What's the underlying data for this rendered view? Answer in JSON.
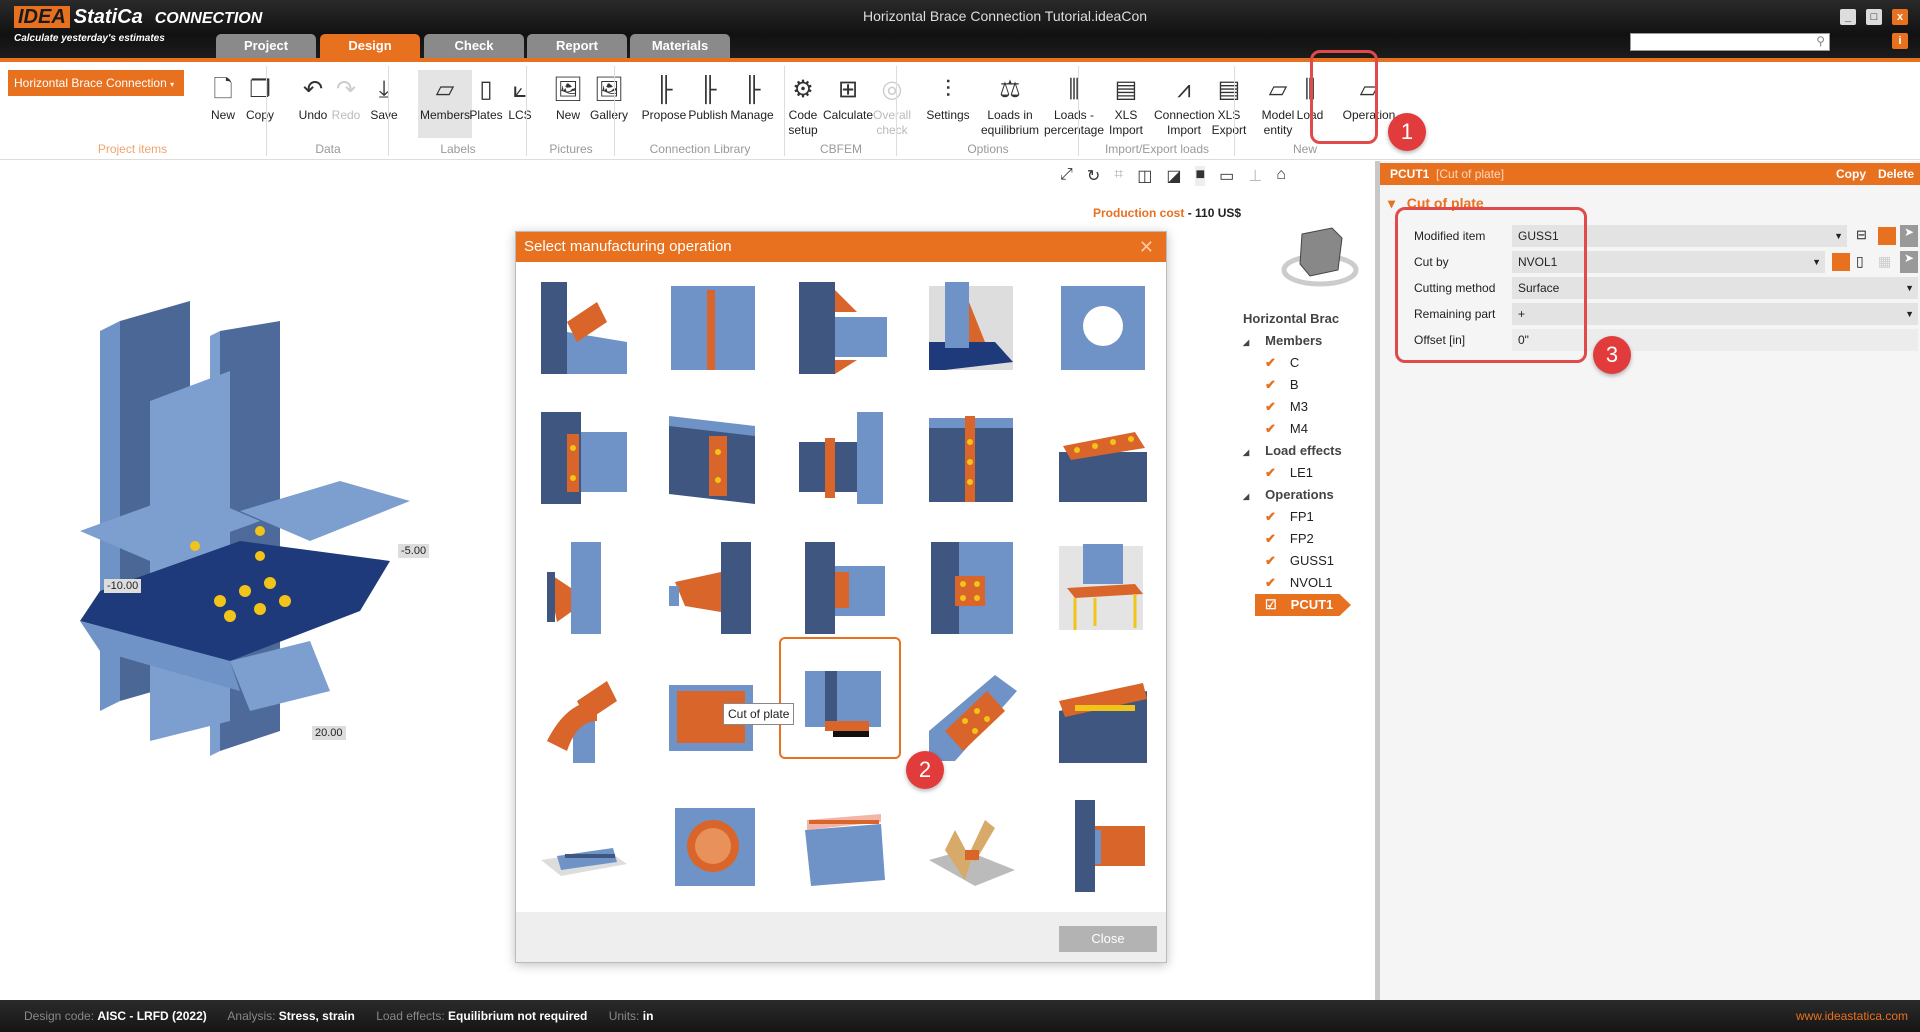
{
  "app": {
    "brand": "IDEA",
    "brand2": "StatiCa",
    "product": "CONNECTION",
    "slogan": "Calculate yesterday's estimates",
    "window_title": "Horizontal Brace Connection Tutorial.ideaCon"
  },
  "tabs": [
    {
      "label": "Project"
    },
    {
      "label": "Design",
      "active": true
    },
    {
      "label": "Check"
    },
    {
      "label": "Report"
    },
    {
      "label": "Materials"
    }
  ],
  "ribbon": {
    "project_selector": "Horizontal Brace Connection",
    "groups": [
      {
        "label": "Project items"
      },
      {
        "label": "Data"
      },
      {
        "label": "Labels"
      },
      {
        "label": "Pictures"
      },
      {
        "label": "Connection Library"
      },
      {
        "label": "CBFEM"
      },
      {
        "label": "Options"
      },
      {
        "label": "Import/Export loads"
      },
      {
        "label": "New"
      }
    ],
    "buttons": [
      {
        "label": "New",
        "icon": "new-item-icon"
      },
      {
        "label": "Copy",
        "icon": "copy-icon"
      },
      {
        "label": "Undo",
        "icon": "undo-icon"
      },
      {
        "label": "Redo",
        "icon": "redo-icon",
        "disabled": true
      },
      {
        "label": "Save",
        "icon": "save-icon"
      },
      {
        "label": "Members",
        "icon": "members-icon",
        "active": true
      },
      {
        "label": "Plates",
        "icon": "plates-icon"
      },
      {
        "label": "LCS",
        "icon": "lcs-icon"
      },
      {
        "label": "New",
        "icon": "new-picture-icon"
      },
      {
        "label": "Gallery",
        "icon": "gallery-icon"
      },
      {
        "label": "Propose",
        "icon": "propose-icon"
      },
      {
        "label": "Publish",
        "icon": "publish-icon"
      },
      {
        "label": "Manage",
        "icon": "manage-icon"
      },
      {
        "label": "Code setup",
        "icon": "code-setup-icon"
      },
      {
        "label": "Calculate",
        "icon": "calculate-icon"
      },
      {
        "label": "Overall check",
        "icon": "overall-check-icon",
        "disabled": true
      },
      {
        "label": "Settings",
        "icon": "settings-icon"
      },
      {
        "label": "Loads in equilibrium",
        "icon": "balance-icon"
      },
      {
        "label": "Loads - percentage",
        "icon": "loads-percentage-icon"
      },
      {
        "label": "XLS Import",
        "icon": "xls-import-icon"
      },
      {
        "label": "Connection Import",
        "icon": "connection-import-icon"
      },
      {
        "label": "XLS Export",
        "icon": "xls-export-icon"
      },
      {
        "label": "Model entity",
        "icon": "model-entity-icon"
      },
      {
        "label": "Load",
        "icon": "load-icon"
      },
      {
        "label": "Operation",
        "icon": "operation-icon"
      }
    ]
  },
  "viewport": {
    "production_cost_label": "Production cost",
    "production_cost_sep": "-",
    "production_cost_value": "110 US$",
    "dims": [
      "-5.00",
      "-10.00",
      "20.00"
    ]
  },
  "tree": {
    "root": "Horizontal Brac",
    "groups": [
      {
        "label": "Members",
        "items": [
          "C",
          "B",
          "M3",
          "M4"
        ]
      },
      {
        "label": "Load effects",
        "items": [
          "LE1"
        ]
      },
      {
        "label": "Operations",
        "items": [
          "FP1",
          "FP2",
          "GUSS1",
          "NVOL1",
          "PCUT1"
        ]
      }
    ],
    "selected": "PCUT1"
  },
  "panel": {
    "id": "PCUT1",
    "type": "[Cut of plate]",
    "copy": "Copy",
    "delete": "Delete",
    "section": "Cut of plate",
    "rows": [
      {
        "label": "Modified item",
        "value": "GUSS1"
      },
      {
        "label": "Cut by",
        "value": "NVOL1"
      },
      {
        "label": "Cutting method",
        "value": "Surface"
      },
      {
        "label": "Remaining part",
        "value": "+"
      },
      {
        "label": "Offset [in]",
        "value": "0\""
      }
    ]
  },
  "dialog": {
    "title": "Select manufacturing operation",
    "tooltip": "Cut of plate",
    "close": "Close",
    "selected_index": 17,
    "tile_count": 25
  },
  "callouts": [
    "1",
    "2",
    "3"
  ],
  "status": {
    "design_code_label": "Design code:",
    "design_code": "AISC - LRFD (2022)",
    "analysis_label": "Analysis:",
    "analysis": "Stress, strain",
    "load_label": "Load effects:",
    "load": "Equilibrium not required",
    "units_label": "Units:",
    "units": "in",
    "website": "www.ideastatica.com"
  },
  "colors": {
    "accent": "#e8711f",
    "steel": "#6f93c6",
    "plate": "#d9652a",
    "callout": "#e23b3b"
  }
}
